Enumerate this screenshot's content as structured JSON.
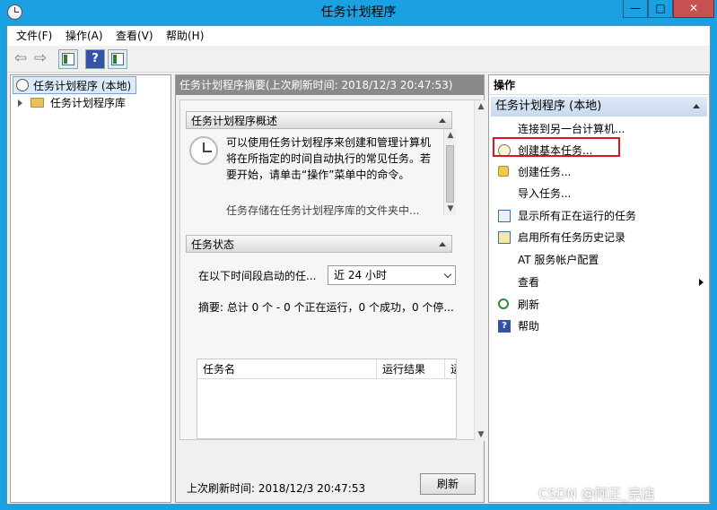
{
  "window": {
    "title": "任务计划程序",
    "minimize_glyph": "—",
    "maximize_glyph": "□",
    "close_glyph": "✕"
  },
  "menu": [
    "文件(F)",
    "操作(A)",
    "查看(V)",
    "帮助(H)"
  ],
  "toolbar": {
    "back_glyph": "⇦",
    "forward_glyph": "⇨",
    "help_glyph": "?"
  },
  "tree": {
    "root": "任务计划程序 (本地)",
    "child": "任务计划程序库"
  },
  "center": {
    "header": "任务计划程序摘要(上次刷新时间: 2018/12/3 20:47:53)",
    "overview_title": "任务计划程序概述",
    "overview_text": "可以使用任务计划程序来创建和管理计算机将在所指定的时间自动执行的常见任务。若要开始，请单击“操作”菜单中的命令。",
    "overview_text2": "任务存储在任务计划程序库的文件夹中...",
    "status_title": "任务状态",
    "period_label": "在以下时间段启动的任...",
    "period_value": "近 24 小时",
    "summary": "摘要: 总计 0 个 - 0 个正在运行，0 个成功，0 个停...",
    "table_headers": [
      "任务名",
      "运行结果",
      "运"
    ],
    "last_refresh": "上次刷新时间: 2018/12/3 20:47:53",
    "refresh_button": "刷新"
  },
  "actions": {
    "header": "操作",
    "group": "任务计划程序 (本地)",
    "items": [
      "连接到另一台计算机...",
      "创建基本任务...",
      "创建任务...",
      "导入任务...",
      "显示所有正在运行的任务",
      "启用所有任务历史记录",
      "AT 服务帐户配置",
      "查看",
      "刷新",
      "帮助"
    ]
  },
  "watermark": "CSDN @阿正_宗店",
  "colors": {
    "titlebar": "#1ba1e2",
    "highlight_border": "#e0141e",
    "selection": "#dcebfc"
  }
}
